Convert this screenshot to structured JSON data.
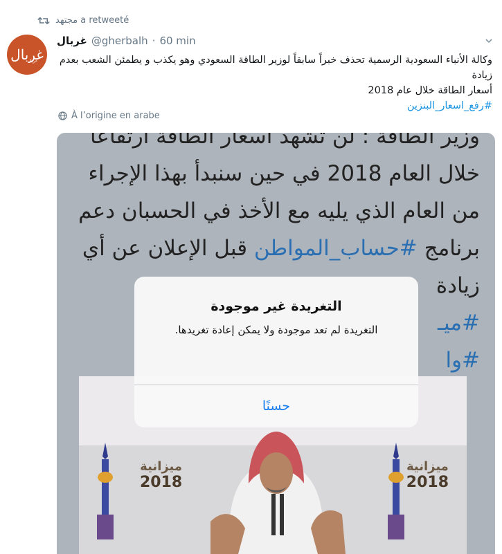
{
  "retweet_context": {
    "text": "مجتهد a retweeté"
  },
  "tweet": {
    "author_name": "غربال",
    "handle": "@gherbalh",
    "separator": "·",
    "time": "60 min",
    "text_line1": "وكالة الأنباء السعودية الرسمية تحذف خبراً سابقاً لوزير الطاقة السعودي وهو يكذب و يطمئن الشعب بعدم زيادة",
    "text_line2": "أسعار الطاقة خلال عام 2018",
    "hashtag": "#رفع_اسعار_البنزين",
    "translate_label": "À l’origine en arabe"
  },
  "avatar": {
    "logo_text": "غربال",
    "logo_subtext": "غربال"
  },
  "media": {
    "lines": [
      "وزير الطاقة : لن تشهد أسعار الطاقة ارتفاعاً",
      "خلال العام 2018 في حين سنبدأ بهذا الإجراء",
      "من العام الذي يليه مع الأخذ في الحسبان دعم",
      "زيادة"
    ],
    "line4_prefix": "برنامج ",
    "line4_tag": "#حساب_المواطن",
    "line4_suffix": " قبل الإعلان عن أي",
    "tag_fragment_1": "#ميـ",
    "tag_fragment_2": "#وا",
    "budget_label": "ميزانية",
    "budget_year": "2018"
  },
  "alert": {
    "title": "التغريدة غير موجودة",
    "message": "التغريدة لم تعد موجودة ولا يمكن إعادة تغريدها.",
    "button": "حسنًا"
  },
  "colors": {
    "link": "#1b95e0",
    "muted": "#657786",
    "alert_button": "#1a7ef0",
    "avatar_bg": "#c9542a"
  }
}
